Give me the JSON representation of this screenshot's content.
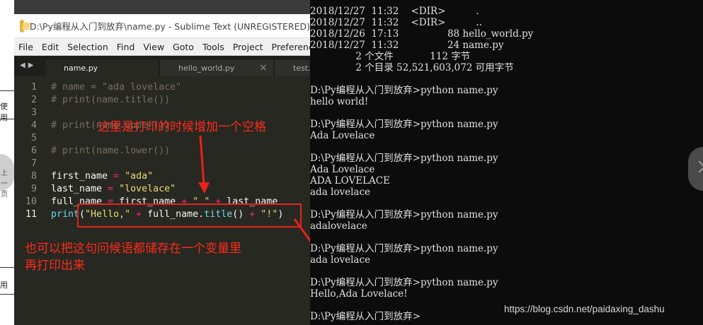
{
  "page_left": {
    "frag1": "使用",
    "frag2": "用",
    "nav_label": "上一页"
  },
  "sublime": {
    "title": "D:\\Py编程从入门到放弃\\name.py - Sublime Text (UNREGISTERED)",
    "menu": [
      "File",
      "Edit",
      "Selection",
      "Find",
      "View",
      "Goto",
      "Tools",
      "Project",
      "Preferences"
    ],
    "tabs": [
      {
        "label": "name.py",
        "active": true
      },
      {
        "label": "hello_world.py",
        "active": false
      },
      {
        "label": "test.r",
        "active": false
      }
    ],
    "tab_arrows": "◀▶",
    "code_lines": [
      {
        "num": "1",
        "tokens": [
          [
            "c-comment",
            "# name = \"ada lovelace\""
          ]
        ]
      },
      {
        "num": "2",
        "tokens": [
          [
            "c-comment",
            "# print(name.title())"
          ]
        ]
      },
      {
        "num": "3",
        "tokens": []
      },
      {
        "num": "4",
        "tokens": [
          [
            "c-comment",
            "# print(name.upper())"
          ]
        ]
      },
      {
        "num": "5",
        "tokens": []
      },
      {
        "num": "6",
        "tokens": [
          [
            "c-comment",
            "# print(name.lower())"
          ]
        ]
      },
      {
        "num": "7",
        "tokens": []
      },
      {
        "num": "8",
        "tokens": [
          [
            "c-var",
            "first_name "
          ],
          [
            "c-op",
            "="
          ],
          [
            "c-var",
            " "
          ],
          [
            "c-str",
            "\"ada\""
          ]
        ]
      },
      {
        "num": "9",
        "tokens": [
          [
            "c-var",
            "last_name "
          ],
          [
            "c-op",
            "="
          ],
          [
            "c-var",
            " "
          ],
          [
            "c-str",
            "\"lovelace\""
          ]
        ]
      },
      {
        "num": "10",
        "tokens": [
          [
            "c-var",
            "full_name "
          ],
          [
            "c-op",
            "="
          ],
          [
            "c-var",
            " first_name "
          ],
          [
            "c-op",
            "+"
          ],
          [
            "c-var",
            " "
          ],
          [
            "c-str",
            "\" \""
          ],
          [
            "c-var",
            " "
          ],
          [
            "c-op",
            "+"
          ],
          [
            "c-var",
            " last_name"
          ]
        ]
      },
      {
        "num": "11",
        "tokens": [
          [
            "c-fn",
            "print"
          ],
          [
            "c-var",
            "("
          ],
          [
            "c-str",
            "\"Hello,\""
          ],
          [
            "c-var",
            " "
          ],
          [
            "c-op",
            "+"
          ],
          [
            "c-var",
            " full_name."
          ],
          [
            "c-fn",
            "title"
          ],
          [
            "c-var",
            "() "
          ],
          [
            "c-op",
            "+"
          ],
          [
            "c-var",
            " "
          ],
          [
            "c-str",
            "\"!\""
          ],
          [
            "c-var",
            ")"
          ]
        ],
        "current": true
      }
    ]
  },
  "annotations": {
    "top": "这里是打印的时候增加一个空格",
    "bottom_line1": "也可以把这句问候语都储存在一个变量里",
    "bottom_line2": "再打印出来",
    "color": "#ff2a1a"
  },
  "console": {
    "lines": [
      "2018/12/27  11:32    <DIR>          .",
      "2018/12/27  11:32    <DIR>          ..",
      "2018/12/26  17:13                88 hello_world.py",
      "2018/12/27  11:32                24 name.py",
      "               2 个文件            112 字节",
      "               2 个目录 52,521,603,072 可用字节",
      "",
      "D:\\Py编程从入门到放弃>python name.py",
      "hello world!",
      "",
      "D:\\Py编程从入门到放弃>python name.py",
      "Ada Lovelace",
      "",
      "D:\\Py编程从入门到放弃>python name.py",
      "Ada Lovelace",
      "ADA LOVELACE",
      "ada lovelace",
      "",
      "D:\\Py编程从入门到放弃>python name.py",
      "adalovelace",
      "",
      "D:\\Py编程从入门到放弃>python name.py",
      "ada lovelace",
      "",
      "D:\\Py编程从入门到放弃>python name.py",
      "Hello,Ada Lovelace!",
      "",
      "D:\\Py编程从入门到放弃>"
    ]
  },
  "watermark": "https://blog.csdn.net/paidaxing_dashu",
  "colors": {
    "editor_bg": "#272822",
    "console_bg": "#0c0c0c",
    "annotation": "#ff2a1a"
  },
  "icons": {
    "app": "sublime-text-icon",
    "next": "chevron-right-icon"
  }
}
